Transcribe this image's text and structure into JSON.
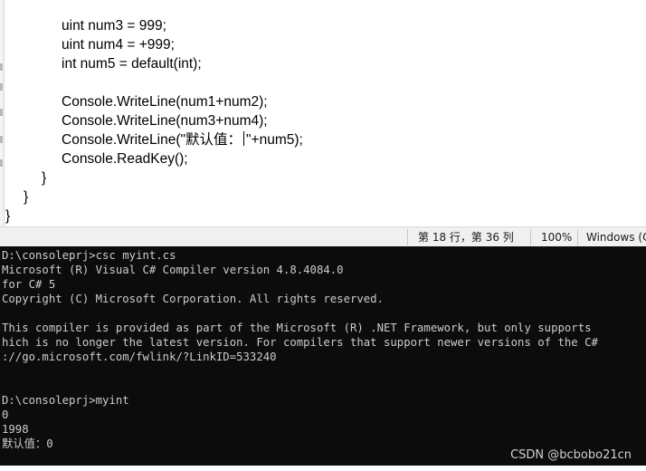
{
  "editor": {
    "lines": [
      "uint num3 = 999;",
      "uint num4 = +999;",
      "int num5 = default(int);",
      "",
      "Console.WriteLine(num1+num2);",
      "Console.WriteLine(num3+num4);",
      "Console.WriteLine(\"默认值：",
      "\"+num5);",
      "Console.ReadKey();",
      "}",
      "}",
      "}"
    ]
  },
  "statusbar": {
    "position": "第 18 行，第 36 列",
    "zoom": "100%",
    "line_ending": "Windows (C"
  },
  "console": {
    "lines": [
      "D:\\consoleprj>csc myint.cs",
      "Microsoft (R) Visual C# Compiler version 4.8.4084.0",
      "for C# 5",
      "Copyright (C) Microsoft Corporation. All rights reserved.",
      "",
      "This compiler is provided as part of the Microsoft (R) .NET Framework, but only supports",
      "hich is no longer the latest version. For compilers that support newer versions of the C#",
      "://go.microsoft.com/fwlink/?LinkID=533240",
      "",
      "",
      "D:\\consoleprj>myint",
      "0",
      "1998",
      "默认值：0"
    ]
  },
  "watermark": "CSDN @bcbobo21cn"
}
